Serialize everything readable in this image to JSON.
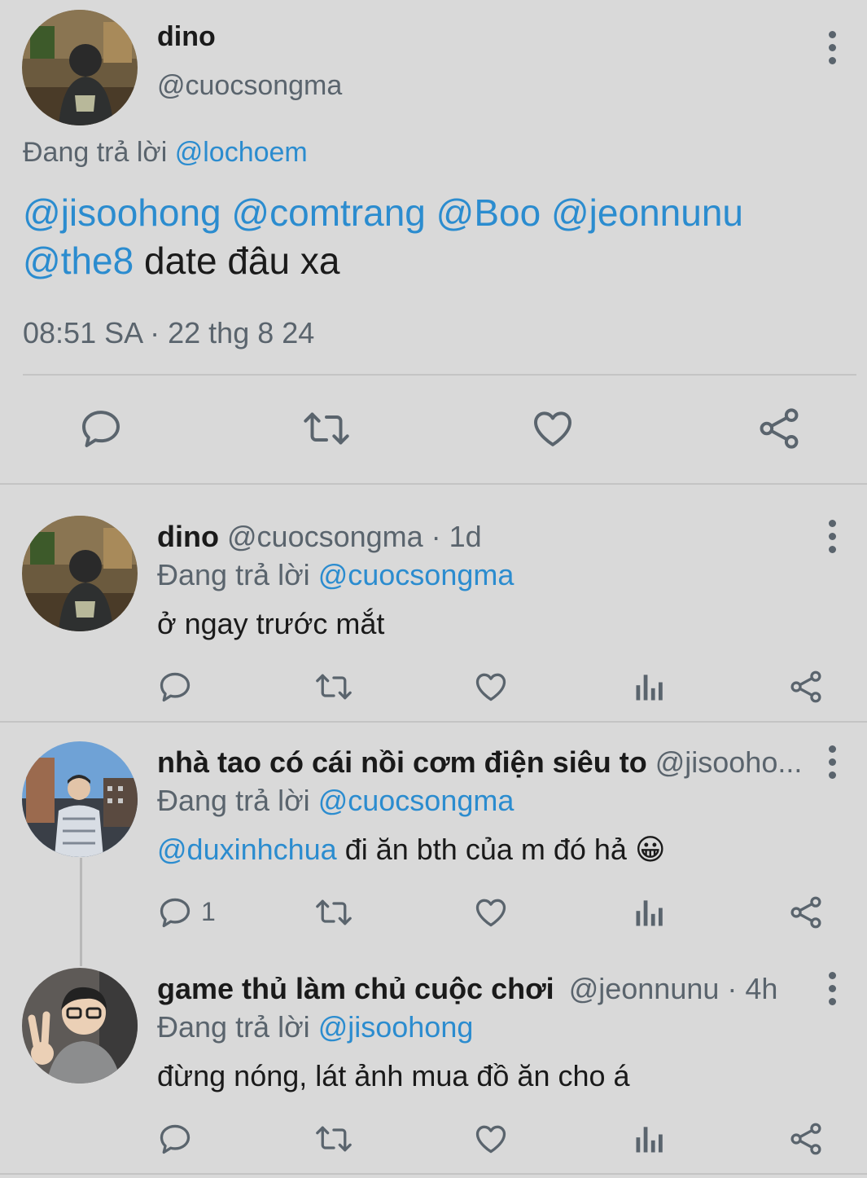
{
  "main_tweet": {
    "display_name": "dino",
    "handle": "@cuocsongma",
    "reply_prefix": "Đang trả lời",
    "reply_to": "@lochoem",
    "mentions": [
      "@jisoohong",
      "@comtrang",
      "@Boo",
      "@jeonnunu",
      "@the8"
    ],
    "text": " date đâu xa",
    "timestamp": "08:51 SA · 22 thg 8 24"
  },
  "replies": [
    {
      "display_name": "dino",
      "handle_time": "@cuocsongma · 1d",
      "reply_prefix": "Đang trả lời",
      "reply_to": "@cuocsongma",
      "text": "ở ngay trước mắt",
      "reply_count": ""
    },
    {
      "display_name": "nhà tao có cái nồi cơm điện siêu to",
      "handle_time": "@jisooho...",
      "reply_prefix": "Đang trả lời",
      "reply_to": "@cuocsongma",
      "mention": "@duxinhchua",
      "text": " đi ăn bth của m đó hả 😀",
      "reply_count": "1"
    },
    {
      "display_name": "game thủ làm chủ cuộc chơi",
      "handle_time": "@jeonnunu · 4h",
      "reply_prefix": "Đang trả lời",
      "reply_to": "@jisoohong",
      "text": "đừng nóng, lát ảnh mua đồ ăn cho á",
      "reply_count": ""
    }
  ],
  "colors": {
    "background": "#d9d9d9",
    "mention": "#2b8ccf",
    "muted": "#5a646d",
    "text": "#1a1a1a"
  },
  "icons": [
    "reply-icon",
    "retweet-icon",
    "like-icon",
    "share-icon",
    "analytics-icon",
    "more-options-icon"
  ]
}
